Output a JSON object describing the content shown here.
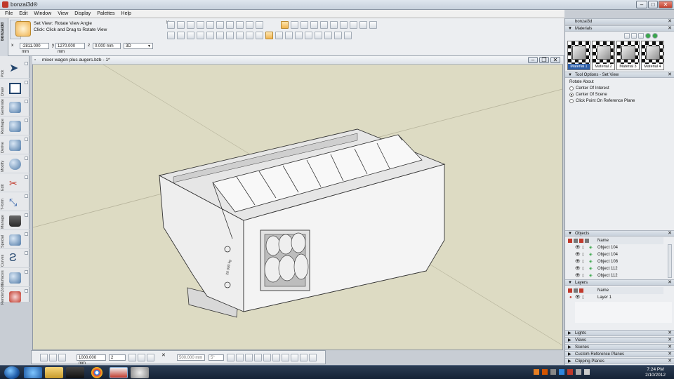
{
  "window": {
    "title": "bonzai3d®"
  },
  "menu": [
    "File",
    "Edit",
    "Window",
    "View",
    "Display",
    "Palettes",
    "Help"
  ],
  "set_view": {
    "label": "Set View:",
    "mode": "Rotate View Angle",
    "hint": "Click: Click and Drag to Rotate View"
  },
  "coords": {
    "x_label": "x",
    "x_value": "-2811.000 mm",
    "y_label": "y",
    "y_value": "1270.000 mm",
    "z_label": "z",
    "z_value": "0.000 mm",
    "view_label": "3D"
  },
  "left_tab": "bonzai3d",
  "tool_categories": [
    "Pick",
    "Draw",
    "Generate",
    "Reshape",
    "Derive",
    "Modify",
    "Edit",
    "T-form",
    "Manage",
    "Special",
    "Curves",
    "Surfaces",
    "RenderZone"
  ],
  "viewport": {
    "title": "mixer wagon plus augers.bzb - 1*",
    "sticker_text": "20 000 kg"
  },
  "bottom_bar": {
    "distance_value": "1000.000 mm",
    "count_value": "2",
    "dist2_value": "500.000 mm",
    "angle_value": "5°"
  },
  "right_panel": {
    "title": "bonzai3d",
    "materials": {
      "header": "Materials",
      "items": [
        "Material 1",
        "Material 2",
        "Material 3",
        "Material 4"
      ]
    },
    "tool_options": {
      "header": "Tool Options - Set View",
      "section_label": "Rotate About",
      "options": [
        "Center Of Interest",
        "Center Of Scene",
        "Click Point On Reference Plane"
      ],
      "selected_index": 1
    },
    "objects": {
      "header": "Objects",
      "column": "Name",
      "rows": [
        "Object 104",
        "Object 104",
        "Object 108",
        "Object 112",
        "Object 112"
      ]
    },
    "layers": {
      "header": "Layers",
      "column": "Name",
      "rows": [
        "Layer 1"
      ]
    },
    "collapsed": [
      "Lights",
      "Views",
      "Scenes",
      "Custom Reference Planes",
      "Clipping Planes"
    ]
  },
  "taskbar": {
    "time": "7:24 PM",
    "date": "2/10/2012"
  }
}
